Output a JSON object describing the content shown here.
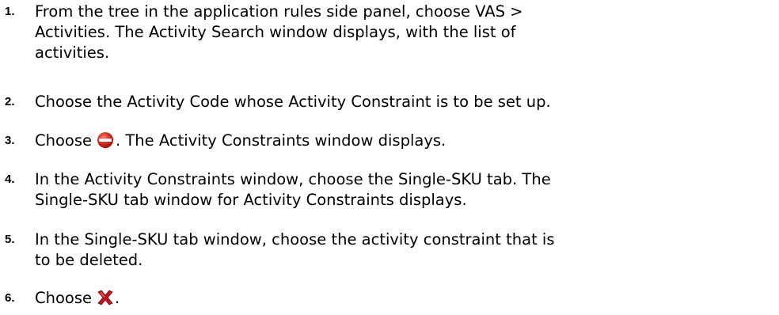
{
  "steps": [
    {
      "number": "1.",
      "lines": [
        "From the tree in the application rules side panel, choose VAS >",
        "Activities. The Activity Search window displays, with the list of",
        "activities."
      ]
    },
    {
      "number": "2.",
      "lines": [
        "Choose the Activity Code whose Activity Constraint is to be set up."
      ]
    },
    {
      "number": "3.",
      "prefix": "Choose",
      "icon": "remove-icon",
      "suffix": ". The Activity Constraints window displays."
    },
    {
      "number": "4.",
      "lines": [
        "In the Activity Constraints window, choose the Single-SKU tab. The",
        "Single-SKU tab window for Activity Constraints displays."
      ]
    },
    {
      "number": "5.",
      "lines": [
        "In the Single-SKU tab window, choose the activity constraint that is",
        "to be deleted."
      ]
    },
    {
      "number": "6.",
      "prefix": "Choose",
      "icon": "delete-x-icon",
      "suffix": "."
    }
  ],
  "colors": {
    "text": "#000000",
    "remove_icon_red": "#d42a1e",
    "delete_icon_red": "#c4121c"
  }
}
